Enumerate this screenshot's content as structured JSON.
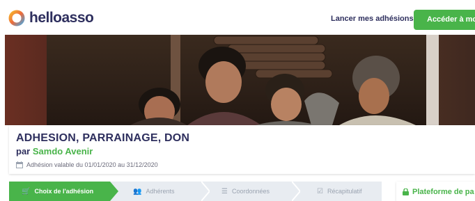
{
  "header": {
    "logo_text": "helloasso",
    "nav_link": "Lancer mes adhésions",
    "cta_label": "Accéder à mon c"
  },
  "campaign": {
    "title": "ADHESION, PARRAINAGE, DON",
    "by_prefix": "par",
    "organization": "Samdo Avenir",
    "validity": "Adhésion valable du 01/01/2020 au 31/12/2020"
  },
  "steps": [
    {
      "label": "Choix de l'adhésion",
      "icon": "cart-icon",
      "active": true
    },
    {
      "label": "Adhérents",
      "icon": "users-icon",
      "active": false
    },
    {
      "label": "Coordonnées",
      "icon": "list-icon",
      "active": false
    },
    {
      "label": "Récapitulatif",
      "icon": "check-square-icon",
      "active": false
    }
  ],
  "side_panel": {
    "title": "Plateforme de pa"
  },
  "colors": {
    "brand_green": "#49b44a",
    "brand_navy": "#2e2f5e",
    "step_bg": "#e8ecf1"
  }
}
